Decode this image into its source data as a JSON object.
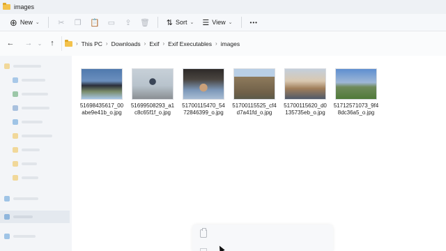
{
  "window": {
    "title": "images",
    "folder_icon": "folder-icon"
  },
  "toolbar": {
    "new_label": "New",
    "sort_label": "Sort",
    "view_label": "View",
    "more_label": "•••",
    "disabled_icons": [
      "cut-icon",
      "copy-icon",
      "paste-icon",
      "rename-icon",
      "share-icon",
      "delete-icon"
    ]
  },
  "nav": {
    "back_icon": "back-arrow-icon",
    "forward_icon": "forward-arrow-icon",
    "up_icon": "up-arrow-icon",
    "breadcrumbs": [
      "This PC",
      "Downloads",
      "Exif",
      "Exif Executables",
      "images"
    ]
  },
  "files": [
    {
      "name": "51698435617_00abe9e41b_o.jpg",
      "thumb_colors": [
        "#5a7fb0",
        "#2b2f3a",
        "#a8c7e8"
      ]
    },
    {
      "name": "51699508293_a1c8c65f1f_o.jpg",
      "thumb_colors": [
        "#b8c3cc",
        "#3a4557",
        "#8a8f93"
      ]
    },
    {
      "name": "51700115470_5472846399_o.jpg",
      "thumb_colors": [
        "#7c97b8",
        "#c9a07a",
        "#2d2a28"
      ]
    },
    {
      "name": "51700115525_cf4d7a41fd_o.jpg",
      "thumb_colors": [
        "#b9cfe6",
        "#8e7a5c",
        "#6f6048"
      ]
    },
    {
      "name": "51700115620_d0135735eb_o.jpg",
      "thumb_colors": [
        "#c4cfdb",
        "#a07e5a",
        "#4f5a6a"
      ]
    },
    {
      "name": "51712571073_9f48dc36a5_o.jpg",
      "thumb_colors": [
        "#5e8fd0",
        "#4f7a3a",
        "#9fb7d6"
      ]
    }
  ],
  "context_menu": {
    "paste_icon": "paste-icon"
  }
}
